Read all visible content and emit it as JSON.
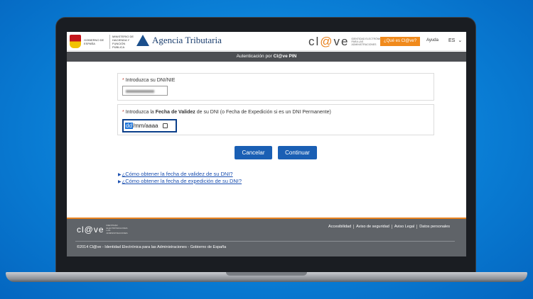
{
  "header": {
    "gob_line1": "GOBIERNO DE ESPAÑA",
    "gob_line2": "MINISTERIO DE HACIENDA Y FUNCIÓN PÚBLICA",
    "agency_name": "Agencia Tributaria",
    "clave_word_start": "cl",
    "clave_word_o": "@",
    "clave_word_end": "ve",
    "clave_subtitle": "IDENTIDAD ELECTRÓNICA PARA LAS ADMINISTRACIONES",
    "que_es_label": "¿Qué es Cl@ve?",
    "ayuda_label": "Ayuda",
    "lang_label": "ES"
  },
  "titlebar": {
    "prefix": "Autenticación por ",
    "bold": "Cl@ve PIN"
  },
  "form": {
    "dni_label": "Introduzca su DNI/NIE",
    "date_label_prefix": "Introduzca la ",
    "date_label_bold": "Fecha de Validez",
    "date_label_suffix": " de su DNI (o Fecha de Expedición si es un DNI Permanente)",
    "date_sel": "dd",
    "date_rest": "/mm/aaaa",
    "cancel_label": "Cancelar",
    "continue_label": "Continuar",
    "link1": "¿Cómo obtener la fecha de validez de su DNI?",
    "link2": "¿Cómo obtener la fecha de expedición de su DNI?"
  },
  "footer": {
    "clave_word": "cl@ve",
    "clave_subtitle": "IDENTIDAD ELECTRÓNICA PARA LAS ADMINISTRACIONES",
    "links": [
      "Accesibilidad",
      "Aviso de seguridad",
      "Aviso Legal",
      "Datos personales"
    ],
    "copyright": "©2014 Cl@ve - Identidad Electrónica para las Administraciones - Gobierno de España"
  },
  "colors": {
    "accent": "#1a5fb4",
    "orange": "#f08a1c",
    "titlebar": "#4d4f53",
    "footer": "#5f6368"
  }
}
